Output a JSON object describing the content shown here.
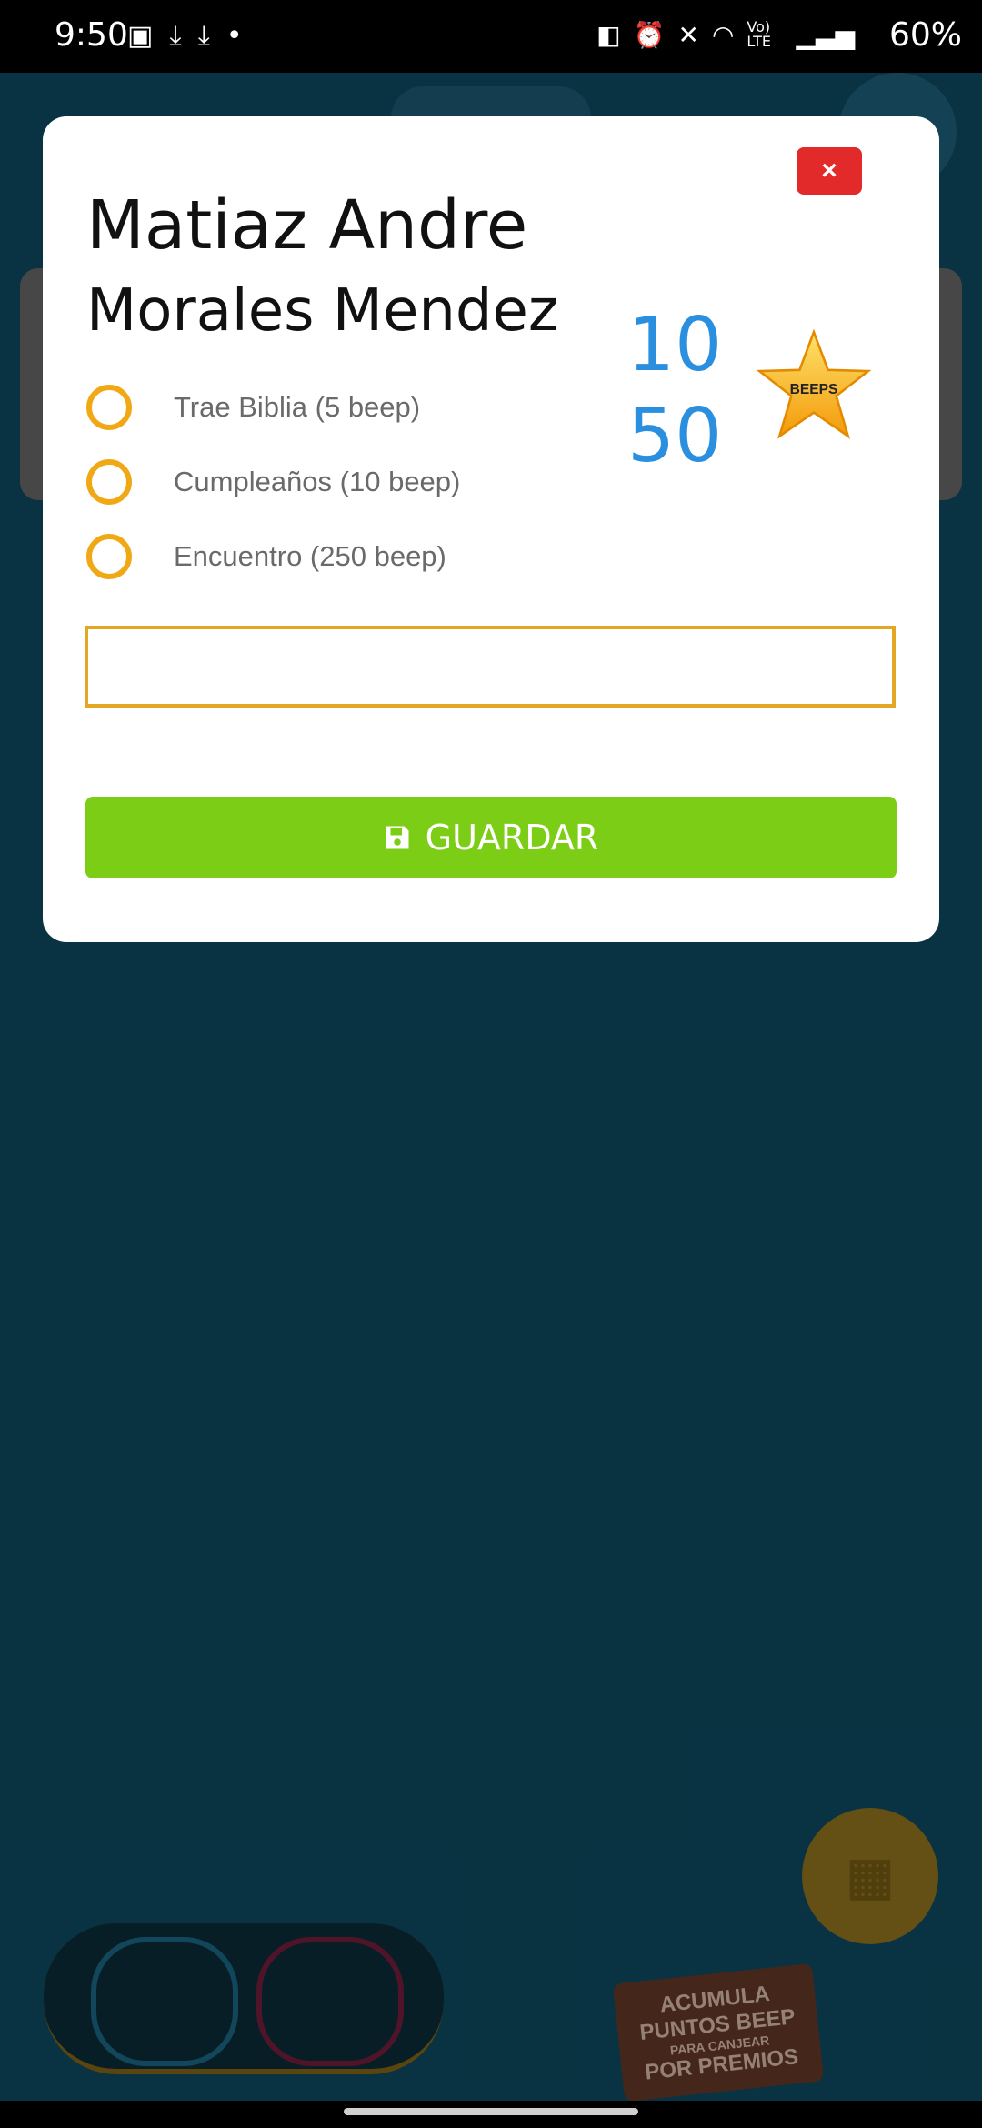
{
  "status_bar": {
    "time": "9:50",
    "left_icons": [
      "image-icon",
      "download-icon",
      "download-icon",
      "dot-icon"
    ],
    "right_icons": [
      "nfc-icon",
      "alarm-icon",
      "mute-icon",
      "wifi-icon",
      "volte-icon",
      "signal-icon"
    ],
    "volte_label": "Vo) LTE",
    "battery": "60%"
  },
  "background": {
    "promo_line1": "ACUMULA",
    "promo_line2": "PUNTOS BEEP",
    "promo_line3": "PARA CANJEAR",
    "promo_line4": "POR PREMIOS"
  },
  "modal": {
    "close_label": "×",
    "name_line1": "Matiaz Andre",
    "name_line2": "Morales Mendez",
    "points_value": "1050",
    "star_label": "BEEPS",
    "options": [
      {
        "label": "Trae Biblia (5 beep)",
        "selected": false
      },
      {
        "label": "Cumpleaños (10 beep)",
        "selected": false
      },
      {
        "label": "Encuentro (250 beep)",
        "selected": false
      }
    ],
    "input_value": "",
    "save_label": "GUARDAR"
  },
  "colors": {
    "accent_orange": "#f0a915",
    "save_green": "#7ccd16",
    "close_red": "#e32a2a",
    "points_blue": "#2b8fe0"
  }
}
